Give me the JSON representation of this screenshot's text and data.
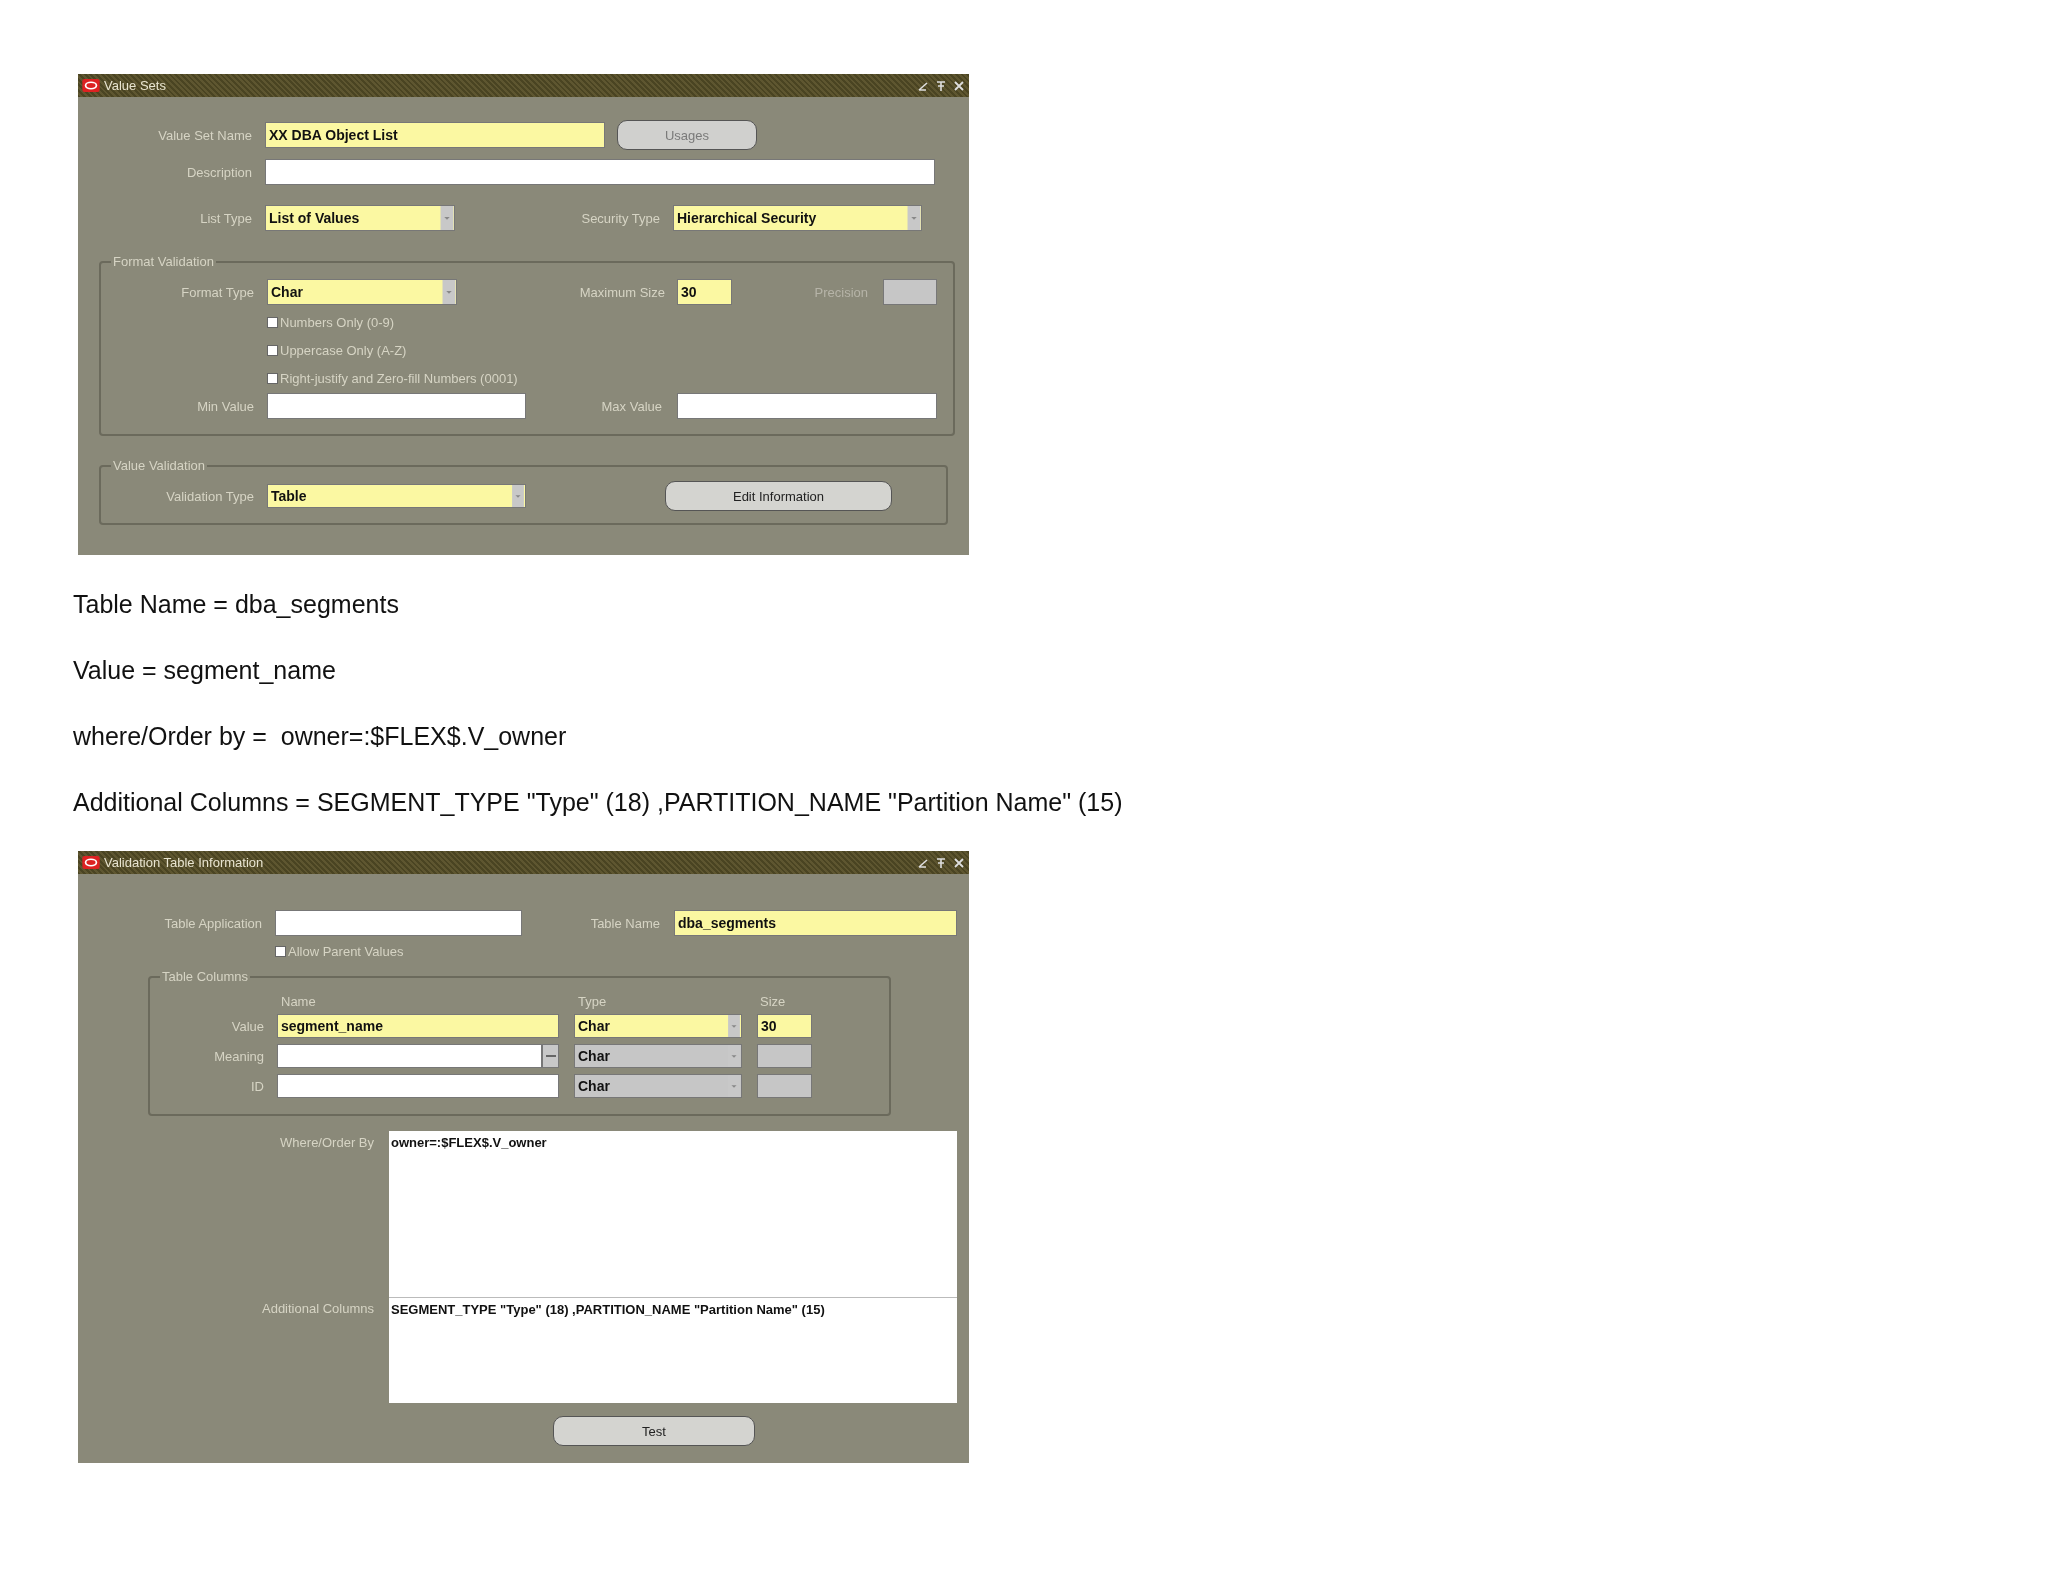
{
  "value_sets_window": {
    "title": "Value Sets",
    "value_set_name": {
      "label": "Value Set Name",
      "value": "XX DBA Object List",
      "required": true
    },
    "usages_button": {
      "label": "Usages",
      "disabled": true
    },
    "description": {
      "label": "Description",
      "required": false
    },
    "list_type": {
      "label": "List Type",
      "value": "List of Values",
      "required": true
    },
    "security_type": {
      "label": "Security Type",
      "value": "Hierarchical Security",
      "required": true
    },
    "format_validation": {
      "title": "Format Validation",
      "format_type": {
        "label": "Format Type",
        "value": "Char",
        "required": true
      },
      "maximum_size": {
        "label": "Maximum Size",
        "value": "30",
        "required": true
      },
      "precision": {
        "label": "Precision",
        "disabled": true
      },
      "checkboxes": [
        {
          "label": "Numbers Only (0-9)",
          "checked": false
        },
        {
          "label": "Uppercase Only (A-Z)",
          "checked": false
        },
        {
          "label": "Right-justify and Zero-fill Numbers (0001)",
          "checked": false
        }
      ],
      "min_value": {
        "label": "Min Value"
      },
      "max_value": {
        "label": "Max Value"
      }
    },
    "value_validation": {
      "title": "Value Validation",
      "validation_type": {
        "label": "Validation Type",
        "value": "Table",
        "required": true
      },
      "edit_button": {
        "label": "Edit Information",
        "disabled": false
      }
    }
  },
  "notes": [
    "Table Name = dba_segments",
    "Value = segment_name",
    "where/Order by =  owner=:$FLEX$.V_owner",
    "Additional Columns = SEGMENT_TYPE \"Type\" (18) ,PARTITION_NAME \"Partition Name\" (15)"
  ],
  "validation_table_window": {
    "title": "Validation Table Information",
    "table_application": {
      "label": "Table Application"
    },
    "table_name": {
      "label": "Table Name",
      "value": "dba_segments",
      "required": true
    },
    "allow_parent_values": {
      "label": "Allow Parent Values",
      "checked": false
    },
    "table_columns": {
      "title": "Table Columns",
      "headers": [
        "Name",
        "Type",
        "Size"
      ],
      "rows": [
        {
          "label": "Value",
          "name": "segment_name",
          "type": "Char",
          "size": "30",
          "required": true,
          "has_lov": false
        },
        {
          "label": "Meaning",
          "type": "Char",
          "required": false,
          "has_lov": true
        },
        {
          "label": "ID",
          "type": "Char",
          "required": false,
          "has_lov": false
        }
      ]
    },
    "where_order_by": {
      "label": "Where/Order By",
      "value": "owner=:$FLEX$.V_owner"
    },
    "additional_columns": {
      "label": "Additional Columns",
      "value": "SEGMENT_TYPE \"Type\" (18) ,PARTITION_NAME \"Partition Name\" (15)"
    },
    "test_button": {
      "label": "Test",
      "disabled": false
    }
  }
}
